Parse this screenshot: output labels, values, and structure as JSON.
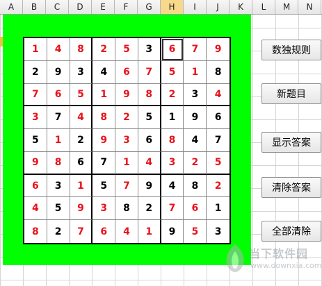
{
  "columns": [
    "A",
    "B",
    "C",
    "D",
    "E",
    "F",
    "G",
    "H",
    "I",
    "J",
    "K",
    "L",
    "M",
    "N"
  ],
  "selected_column": "H",
  "board": {
    "rows": [
      [
        {
          "v": "1",
          "c": "r"
        },
        {
          "v": "4",
          "c": "r"
        },
        {
          "v": "8",
          "c": "r"
        },
        {
          "v": "2",
          "c": "r"
        },
        {
          "v": "5",
          "c": "r"
        },
        {
          "v": "3",
          "c": "b"
        },
        {
          "v": "6",
          "c": "r"
        },
        {
          "v": "7",
          "c": "r"
        },
        {
          "v": "9",
          "c": "r"
        }
      ],
      [
        {
          "v": "2",
          "c": "b"
        },
        {
          "v": "9",
          "c": "b"
        },
        {
          "v": "3",
          "c": "b"
        },
        {
          "v": "4",
          "c": "b"
        },
        {
          "v": "6",
          "c": "r"
        },
        {
          "v": "7",
          "c": "r"
        },
        {
          "v": "5",
          "c": "r"
        },
        {
          "v": "1",
          "c": "r"
        },
        {
          "v": "8",
          "c": "b"
        }
      ],
      [
        {
          "v": "7",
          "c": "r"
        },
        {
          "v": "6",
          "c": "r"
        },
        {
          "v": "5",
          "c": "r"
        },
        {
          "v": "1",
          "c": "r"
        },
        {
          "v": "9",
          "c": "r"
        },
        {
          "v": "8",
          "c": "r"
        },
        {
          "v": "2",
          "c": "r"
        },
        {
          "v": "3",
          "c": "b"
        },
        {
          "v": "4",
          "c": "r"
        }
      ],
      [
        {
          "v": "3",
          "c": "r"
        },
        {
          "v": "7",
          "c": "b"
        },
        {
          "v": "4",
          "c": "r"
        },
        {
          "v": "8",
          "c": "r"
        },
        {
          "v": "2",
          "c": "r"
        },
        {
          "v": "5",
          "c": "b"
        },
        {
          "v": "1",
          "c": "b"
        },
        {
          "v": "9",
          "c": "b"
        },
        {
          "v": "6",
          "c": "b"
        }
      ],
      [
        {
          "v": "5",
          "c": "b"
        },
        {
          "v": "1",
          "c": "r"
        },
        {
          "v": "2",
          "c": "b"
        },
        {
          "v": "9",
          "c": "r"
        },
        {
          "v": "3",
          "c": "r"
        },
        {
          "v": "6",
          "c": "b"
        },
        {
          "v": "8",
          "c": "r"
        },
        {
          "v": "4",
          "c": "b"
        },
        {
          "v": "7",
          "c": "b"
        }
      ],
      [
        {
          "v": "9",
          "c": "r"
        },
        {
          "v": "8",
          "c": "r"
        },
        {
          "v": "6",
          "c": "b"
        },
        {
          "v": "7",
          "c": "b"
        },
        {
          "v": "1",
          "c": "r"
        },
        {
          "v": "4",
          "c": "r"
        },
        {
          "v": "3",
          "c": "r"
        },
        {
          "v": "2",
          "c": "r"
        },
        {
          "v": "5",
          "c": "r"
        }
      ],
      [
        {
          "v": "6",
          "c": "r"
        },
        {
          "v": "3",
          "c": "b"
        },
        {
          "v": "1",
          "c": "r"
        },
        {
          "v": "5",
          "c": "b"
        },
        {
          "v": "7",
          "c": "r"
        },
        {
          "v": "9",
          "c": "b"
        },
        {
          "v": "4",
          "c": "b"
        },
        {
          "v": "8",
          "c": "b"
        },
        {
          "v": "2",
          "c": "r"
        }
      ],
      [
        {
          "v": "4",
          "c": "r"
        },
        {
          "v": "5",
          "c": "b"
        },
        {
          "v": "9",
          "c": "r"
        },
        {
          "v": "3",
          "c": "r"
        },
        {
          "v": "8",
          "c": "b"
        },
        {
          "v": "2",
          "c": "b"
        },
        {
          "v": "7",
          "c": "r"
        },
        {
          "v": "6",
          "c": "r"
        },
        {
          "v": "1",
          "c": "b"
        }
      ],
      [
        {
          "v": "8",
          "c": "r"
        },
        {
          "v": "2",
          "c": "b"
        },
        {
          "v": "7",
          "c": "r"
        },
        {
          "v": "6",
          "c": "r"
        },
        {
          "v": "4",
          "c": "r"
        },
        {
          "v": "1",
          "c": "r"
        },
        {
          "v": "9",
          "c": "b"
        },
        {
          "v": "5",
          "c": "r"
        },
        {
          "v": "3",
          "c": "b"
        }
      ]
    ],
    "active_cell": {
      "row": 0,
      "col": 6
    }
  },
  "buttons": {
    "rules": "数独规则",
    "new_puzzle": "新题目",
    "show_answer": "显示答案",
    "clear_answer": "清除答案",
    "clear_all": "全部清除"
  },
  "watermark": {
    "text": "当下软件园",
    "url": "www.downxia.com"
  },
  "colors": {
    "background_green": "#00ff00",
    "given_red": "#e8131c",
    "entered_black": "#000000"
  }
}
